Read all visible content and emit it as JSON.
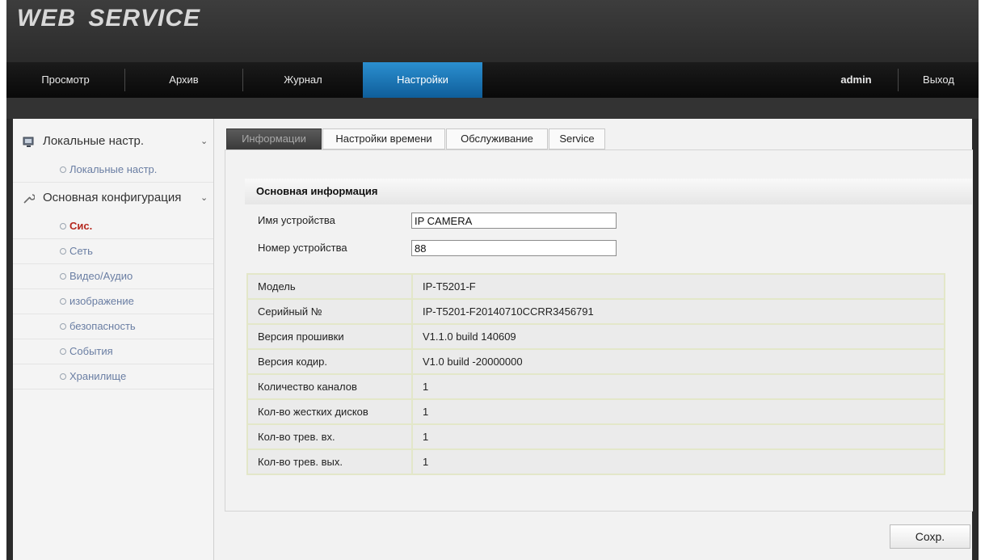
{
  "header": {
    "logo": "WEB SERVICE"
  },
  "nav": {
    "items": [
      "Просмотр",
      "Архив",
      "Журнал",
      "Настройки"
    ],
    "active": "Настройки",
    "user": "admin",
    "logout": "Выход"
  },
  "sidebar": {
    "groups": [
      {
        "label": "Локальные настр.",
        "icon": "monitor-icon",
        "items": [
          "Локальные настр."
        ]
      },
      {
        "label": "Основная конфигурация",
        "icon": "wrench-icon",
        "items": [
          "Сис.",
          "Сеть",
          "Видео/Аудио",
          "изображение",
          "безопасность",
          "События",
          "Хранилище"
        ]
      }
    ],
    "active_item": "Сис."
  },
  "tabs": [
    "Информации",
    "Настройки времени",
    "Обслуживание",
    "Service"
  ],
  "active_tab": "Информации",
  "basic_info": {
    "title": "Основная информация",
    "device_name_label": "Имя устройства",
    "device_name_value": "IP CAMERA",
    "device_no_label": "Номер устройства",
    "device_no_value": "88"
  },
  "info_rows": [
    {
      "key": "Модель",
      "value": "IP-T5201-F"
    },
    {
      "key": "Серийный №",
      "value": "IP-T5201-F20140710CCRR3456791"
    },
    {
      "key": "Версия прошивки",
      "value": "V1.1.0 build 140609"
    },
    {
      "key": "Версия кодир.",
      "value": "V1.0 build -20000000"
    },
    {
      "key": "Количество каналов",
      "value": "1"
    },
    {
      "key": "Кол-во жестких дисков",
      "value": "1"
    },
    {
      "key": "Кол-во трев. вх.",
      "value": "1"
    },
    {
      "key": "Кол-во трев. вых.",
      "value": "1"
    }
  ],
  "save_label": "Сохр.",
  "colors": {
    "accent": "#1b74b8",
    "active_side": "#b5281e",
    "side_link": "#6a7ea3"
  }
}
